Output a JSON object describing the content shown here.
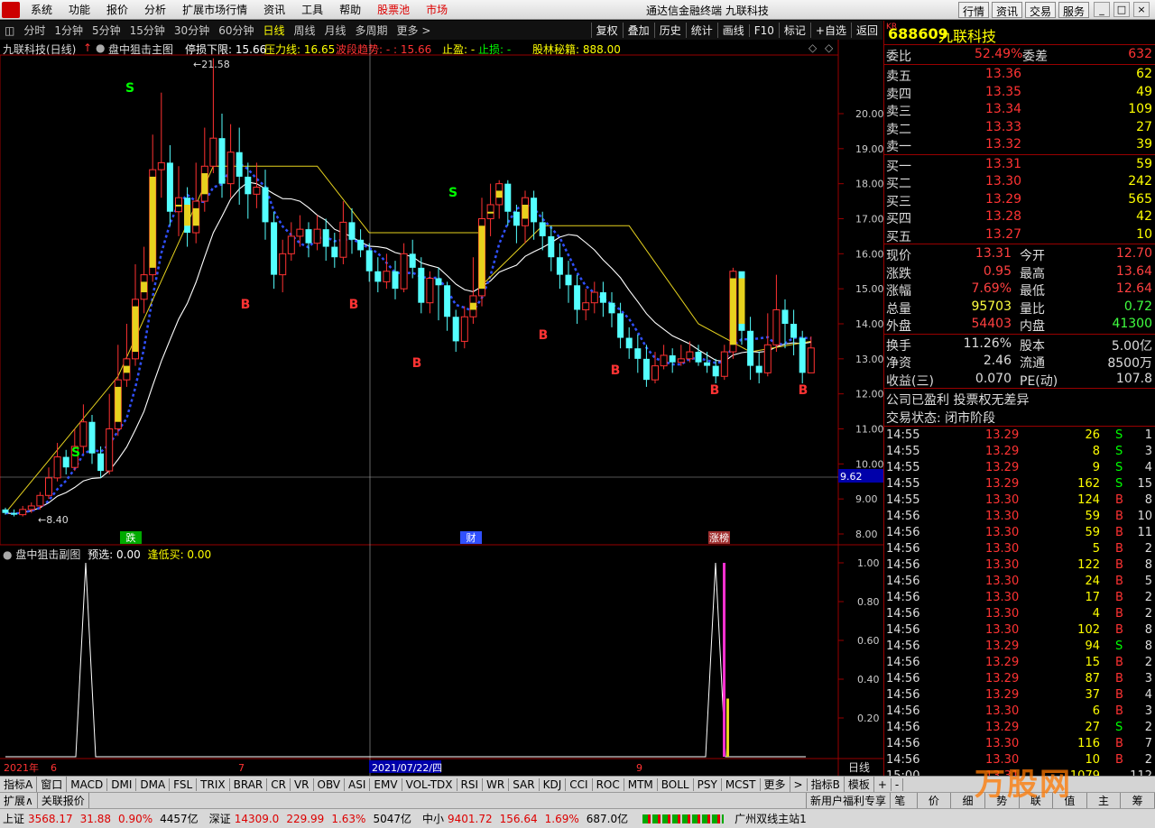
{
  "menu": {
    "items": [
      "系统",
      "功能",
      "报价",
      "分析",
      "扩展市场行情",
      "资讯",
      "工具",
      "帮助"
    ],
    "stock_pool": "股票池",
    "market": "市场",
    "app_title": "通达信金融终端  九联科技",
    "right_buttons": [
      "行情",
      "资讯",
      "交易",
      "服务"
    ]
  },
  "periods": [
    "分时",
    "1分钟",
    "5分钟",
    "15分钟",
    "30分钟",
    "60分钟",
    "日线",
    "周线",
    "月线",
    "多周期",
    "更多 >"
  ],
  "active_period": "日线",
  "tools": [
    "复权",
    "叠加",
    "历史",
    "统计",
    "画线",
    "F10",
    "标记",
    "+自选",
    "返回"
  ],
  "chart_header": {
    "stock": "九联科技(日线)",
    "main_indicator": "盘中狙击主图",
    "limit_down": "停损下限: 15.66",
    "pressure": "压力线: 16.65",
    "wave": "波段趋势: - : 15.66",
    "take_profit": "止盈: -",
    "stop_loss": "止损: -",
    "secret": "股林秘籍: 888.00"
  },
  "sub_header": {
    "name": "盘中狙击副图",
    "preselect": "预选: 0.00",
    "buy_low": "逢低买: 0.00"
  },
  "chart_data": {
    "type": "candlestick",
    "y_axis": [
      20.0,
      19.0,
      18.0,
      17.0,
      16.0,
      15.0,
      14.0,
      13.0,
      12.0,
      11.0,
      10.0,
      9.0,
      8.0
    ],
    "high_label": "21.58",
    "low_label": "8.40",
    "crosshair_price": "9.62",
    "x_labels": [
      "2021年",
      "6",
      "7",
      "2021/07/22/四",
      "9"
    ],
    "event_labels": [
      "跌",
      "财",
      "涨榜"
    ],
    "signals": [
      "S",
      "S",
      "S",
      "B",
      "B",
      "B",
      "B",
      "B",
      "B",
      "B"
    ],
    "sub_y_axis": [
      "1.00",
      "0.80",
      "0.60",
      "0.40",
      "0.20"
    ],
    "right_label": "日线"
  },
  "quote": {
    "market_tag": "KR",
    "code": "688609",
    "name": "九联科技",
    "wei_bi_label": "委比",
    "wei_bi": "52.49%",
    "wei_cha_label": "委差",
    "wei_cha": "632",
    "sells": [
      {
        "label": "卖五",
        "price": "13.36",
        "vol": "62"
      },
      {
        "label": "卖四",
        "price": "13.35",
        "vol": "49"
      },
      {
        "label": "卖三",
        "price": "13.34",
        "vol": "109"
      },
      {
        "label": "卖二",
        "price": "13.33",
        "vol": "27"
      },
      {
        "label": "卖一",
        "price": "13.32",
        "vol": "39"
      }
    ],
    "buys": [
      {
        "label": "买一",
        "price": "13.31",
        "vol": "59"
      },
      {
        "label": "买二",
        "price": "13.30",
        "vol": "242"
      },
      {
        "label": "买三",
        "price": "13.29",
        "vol": "565"
      },
      {
        "label": "买四",
        "price": "13.28",
        "vol": "42"
      },
      {
        "label": "买五",
        "price": "13.27",
        "vol": "10"
      }
    ],
    "stats": [
      {
        "l1": "现价",
        "v1": "13.31",
        "l2": "今开",
        "v2": "12.70",
        "c1": "#ff4040",
        "c2": "#ff4040"
      },
      {
        "l1": "涨跌",
        "v1": "0.95",
        "l2": "最高",
        "v2": "13.64",
        "c1": "#ff4040",
        "c2": "#ff4040"
      },
      {
        "l1": "涨幅",
        "v1": "7.69%",
        "l2": "最低",
        "v2": "12.64",
        "c1": "#ff4040",
        "c2": "#ff4040"
      },
      {
        "l1": "总量",
        "v1": "95703",
        "l2": "量比",
        "v2": "0.72",
        "c1": "#ffff40",
        "c2": "#40ff40"
      },
      {
        "l1": "外盘",
        "v1": "54403",
        "l2": "内盘",
        "v2": "41300",
        "c1": "#ff4040",
        "c2": "#40ff40"
      }
    ],
    "fund": [
      {
        "l1": "换手",
        "v1": "11.26%",
        "l2": "股本",
        "v2": "5.00亿"
      },
      {
        "l1": "净资",
        "v1": "2.46",
        "l2": "流通",
        "v2": "8500万"
      },
      {
        "l1": "收益(三)",
        "v1": "0.070",
        "l2": "PE(动)",
        "v2": "107.8"
      }
    ],
    "notice": "公司已盈利 投票权无差异",
    "trade_status": "交易状态: 闭市阶段",
    "ticks": [
      {
        "t": "14:55",
        "p": "13.29",
        "v": "26",
        "s": "S",
        "n": "1"
      },
      {
        "t": "14:55",
        "p": "13.29",
        "v": "8",
        "s": "S",
        "n": "3"
      },
      {
        "t": "14:55",
        "p": "13.29",
        "v": "9",
        "s": "S",
        "n": "4"
      },
      {
        "t": "14:55",
        "p": "13.29",
        "v": "162",
        "s": "S",
        "n": "15"
      },
      {
        "t": "14:55",
        "p": "13.30",
        "v": "124",
        "s": "B",
        "n": "8"
      },
      {
        "t": "14:56",
        "p": "13.30",
        "v": "59",
        "s": "B",
        "n": "10"
      },
      {
        "t": "14:56",
        "p": "13.30",
        "v": "59",
        "s": "B",
        "n": "11"
      },
      {
        "t": "14:56",
        "p": "13.30",
        "v": "5",
        "s": "B",
        "n": "2"
      },
      {
        "t": "14:56",
        "p": "13.30",
        "v": "122",
        "s": "B",
        "n": "8"
      },
      {
        "t": "14:56",
        "p": "13.30",
        "v": "24",
        "s": "B",
        "n": "5"
      },
      {
        "t": "14:56",
        "p": "13.30",
        "v": "17",
        "s": "B",
        "n": "2"
      },
      {
        "t": "14:56",
        "p": "13.30",
        "v": "4",
        "s": "B",
        "n": "2"
      },
      {
        "t": "14:56",
        "p": "13.30",
        "v": "102",
        "s": "B",
        "n": "8"
      },
      {
        "t": "14:56",
        "p": "13.29",
        "v": "94",
        "s": "S",
        "n": "8"
      },
      {
        "t": "14:56",
        "p": "13.29",
        "v": "15",
        "s": "B",
        "n": "2"
      },
      {
        "t": "14:56",
        "p": "13.29",
        "v": "87",
        "s": "B",
        "n": "3"
      },
      {
        "t": "14:56",
        "p": "13.29",
        "v": "37",
        "s": "B",
        "n": "4"
      },
      {
        "t": "14:56",
        "p": "13.30",
        "v": "6",
        "s": "B",
        "n": "3"
      },
      {
        "t": "14:56",
        "p": "13.29",
        "v": "27",
        "s": "S",
        "n": "2"
      },
      {
        "t": "14:56",
        "p": "13.30",
        "v": "116",
        "s": "B",
        "n": "7"
      },
      {
        "t": "14:56",
        "p": "13.30",
        "v": "10",
        "s": "B",
        "n": "2"
      },
      {
        "t": "15:00",
        "p": "13.31",
        "v": "1079",
        "s": "",
        "n": "112"
      }
    ]
  },
  "indicator_tabs": [
    "指标A",
    "窗口",
    "MACD",
    "DMI",
    "DMA",
    "FSL",
    "TRIX",
    "BRAR",
    "CR",
    "VR",
    "OBV",
    "ASI",
    "EMV",
    "VOL-TDX",
    "RSI",
    "WR",
    "SAR",
    "KDJ",
    "CCI",
    "ROC",
    "MTM",
    "BOLL",
    "PSY",
    "MCST",
    "更多",
    ">",
    "指标B",
    "模板",
    "+",
    "-"
  ],
  "ext_bar": {
    "ext": "扩展∧",
    "related": "关联报价",
    "promo": "新用户福利专享",
    "right_tabs": [
      "笔",
      "价",
      "细",
      "势",
      "联",
      "值",
      "主",
      "筹"
    ]
  },
  "status": {
    "sh": "上证",
    "sh_v": "3568.17",
    "sh_c": "31.88",
    "sh_p": "0.90%",
    "sh_a": "4457亿",
    "sz": "深证",
    "sz_v": "14309.0",
    "sz_c": "229.99",
    "sz_p": "1.63%",
    "sz_a": "5047亿",
    "zx": "中小",
    "zx_v": "9401.72",
    "zx_c": "156.64",
    "zx_p": "1.69%",
    "zx_a": "687.0亿",
    "server": "广州双线主站1"
  },
  "watermark": "万股网"
}
